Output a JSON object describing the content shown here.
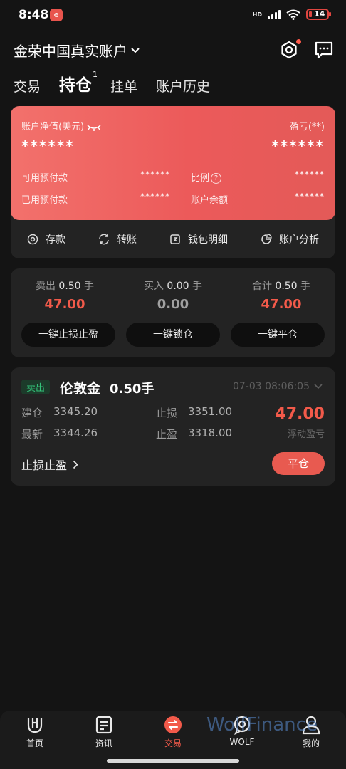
{
  "status_bar": {
    "time": "8:48",
    "network": "HD",
    "battery": "14"
  },
  "header": {
    "account_title": "金荣中国真实账户",
    "icons": [
      "settings-icon",
      "message-icon"
    ]
  },
  "tabs": [
    {
      "label": "交易",
      "active": false
    },
    {
      "label": "持仓",
      "active": true,
      "badge": "1"
    },
    {
      "label": "挂单",
      "active": false
    },
    {
      "label": "账户历史",
      "active": false
    }
  ],
  "account_card": {
    "equity_label": "账户净值(美元)",
    "equity_value": "******",
    "pnl_label": "盈亏(**)",
    "pnl_value": "******",
    "free_margin_label": "可用预付款",
    "free_margin_value": "******",
    "ratio_label": "比例",
    "ratio_value": "******",
    "used_margin_label": "已用预付款",
    "used_margin_value": "******",
    "balance_label": "账户余额",
    "balance_value": "******"
  },
  "card_actions": [
    {
      "label": "存款",
      "icon": "deposit-icon"
    },
    {
      "label": "转账",
      "icon": "transfer-icon"
    },
    {
      "label": "钱包明细",
      "icon": "wallet-icon"
    },
    {
      "label": "账户分析",
      "icon": "pie-chart-icon"
    }
  ],
  "summary": {
    "sell_label": "卖出",
    "sell_lots": "0.50",
    "sell_unit": "手",
    "sell_value": "47.00",
    "buy_label": "买入",
    "buy_lots": "0.00",
    "buy_unit": "手",
    "buy_value": "0.00",
    "total_label": "合计",
    "total_lots": "0.50",
    "total_unit": "手",
    "total_value": "47.00",
    "btn_sltp": "一键止损止盈",
    "btn_lock": "一键锁仓",
    "btn_close_all": "一键平仓"
  },
  "position": {
    "side": "卖出",
    "symbol": "伦敦金",
    "lots": "0.50手",
    "timestamp": "07-03 08:06:05",
    "open_label": "建仓",
    "open_price": "3345.20",
    "latest_label": "最新",
    "latest_price": "3344.26",
    "sl_label": "止损",
    "sl_price": "3351.00",
    "tp_label": "止盈",
    "tp_price": "3318.00",
    "floating_pnl": "47.00",
    "floating_pnl_label": "浮动盈亏",
    "sltp_link": "止损止盈",
    "close_button": "平仓"
  },
  "bottom_nav": [
    {
      "label": "首页",
      "icon": "home-logo-icon",
      "active": false
    },
    {
      "label": "资讯",
      "icon": "news-icon",
      "active": false
    },
    {
      "label": "交易",
      "icon": "trade-icon",
      "active": true
    },
    {
      "label": "WOLF",
      "icon": "chat-bubble-icon",
      "active": false
    },
    {
      "label": "我的",
      "icon": "profile-icon",
      "active": false
    }
  ],
  "watermark": "WolfFinance",
  "colors": {
    "accent_red": "#f25a4a",
    "card_gradient_start": "#f2716c",
    "card_gradient_end": "#e35a58",
    "background": "#141414",
    "panel": "#232323",
    "sell_tag_green": "#33c37a"
  }
}
